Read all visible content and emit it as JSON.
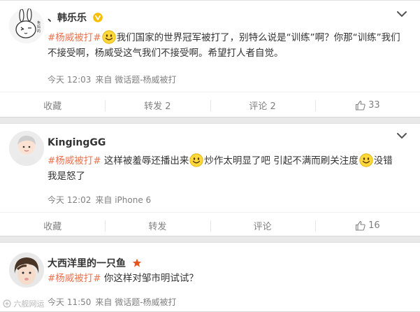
{
  "posts": [
    {
      "author": "、韩乐乐",
      "content": {
        "tag": "#杨威被打#",
        "line1": "我们国家的世界冠军被打了，别特么说是“训练”啊？你那“训练”我们",
        "line2": "不接受啊，杨威受这气我们不接受啊。希望打人者自觉。"
      },
      "time": "今天 12:03",
      "source": "来自 微话题-杨威被打",
      "actions": {
        "collect": "收藏",
        "repost": "转发 2",
        "comment": "评论 2",
        "like": "33"
      }
    },
    {
      "author": "KingingGG",
      "content": {
        "tag": "#杨威被打#",
        "seg1": " 这样被羞辱还播出来",
        "seg2": "炒作太明显了吧 引起不满而刷关注度",
        "seg3": "没错",
        "line2": "我是怒了"
      },
      "time": "今天 12:02",
      "source": "来自 iPhone 6",
      "actions": {
        "collect": "收藏",
        "repost": "转发",
        "comment": "评论",
        "like": "16"
      }
    },
    {
      "author": "大西洋里的一只鱼",
      "content": {
        "tag": "#杨威被打#",
        "seg1": " 你这样对邹市明试试？"
      },
      "time": "今天 11:50",
      "source": "来自 微话题-杨威被打",
      "watermark": "六舰网运"
    }
  ],
  "colors": {
    "tag": "#eb7350",
    "meta": "#808080",
    "badge": "#f6c000",
    "star": "#e8541e"
  }
}
